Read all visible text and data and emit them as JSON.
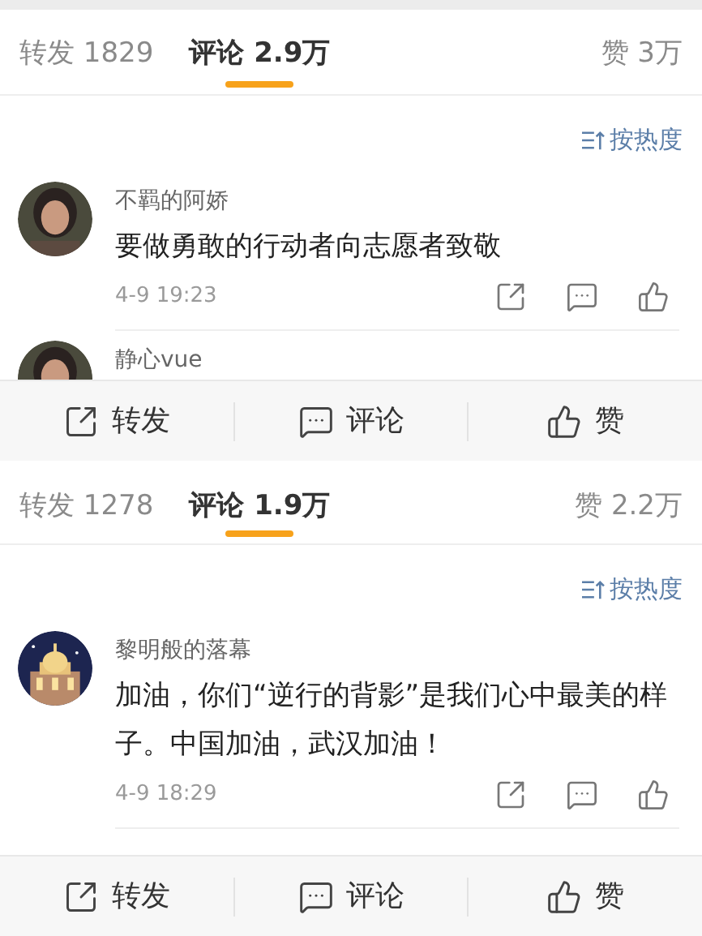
{
  "panels": [
    {
      "tabs": [
        {
          "label": "转发",
          "count": "1829",
          "selected": false
        },
        {
          "label": "评论",
          "count": "2.9万",
          "selected": true
        },
        {
          "label": "赞",
          "count": "3万",
          "selected": false
        }
      ],
      "sort": "按热度",
      "comments": [
        {
          "name": "不羁的阿娇",
          "text": "要做勇敢的行动者向志愿者致敬",
          "time": "4-9 19:23",
          "kind": "picture"
        },
        {
          "name": "静心vue",
          "kind": "picture"
        }
      ],
      "actions": [
        {
          "kind": "repost",
          "label": "转发"
        },
        {
          "kind": "comment",
          "label": "评论"
        },
        {
          "kind": "like",
          "label": "赞"
        }
      ]
    },
    {
      "tabs": [
        {
          "label": "转发",
          "count": "1278",
          "selected": false
        },
        {
          "label": "评论",
          "count": "1.9万",
          "selected": true
        },
        {
          "label": "赞",
          "count": "2.2万",
          "selected": false
        }
      ],
      "sort": "按热度",
      "comments": [
        {
          "name": "黎明般的落幕",
          "text": "加油，你们“逆行的背影”是我们心中最美的样子。中国加油，武汉加油！",
          "time": "4-9 18:29",
          "kind": "picture"
        }
      ],
      "actions": [
        {
          "kind": "repost",
          "label": "转发"
        },
        {
          "kind": "comment",
          "label": "评论"
        },
        {
          "kind": "like",
          "label": "赞"
        }
      ]
    }
  ]
}
